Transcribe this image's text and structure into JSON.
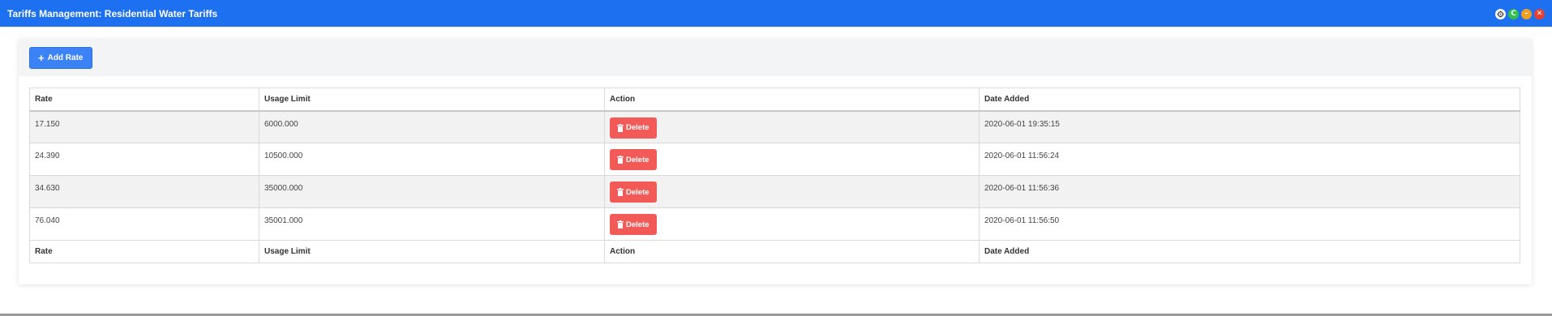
{
  "window": {
    "title": "Tariffs Management: Residential Water Tariffs",
    "controls": {
      "settings_icon": "gear-icon",
      "refresh_icon": "refresh-icon",
      "minimize_icon": "minimize-icon",
      "close_icon": "close-icon",
      "refresh_glyph": "C",
      "minimize_glyph": "–",
      "close_glyph": "✕"
    },
    "colors": {
      "titlebar": "#1d70f0"
    }
  },
  "toolbar": {
    "add_label": "Add Rate",
    "add_icon": "plus-icon"
  },
  "table": {
    "headers": [
      "Rate",
      "Usage Limit",
      "Action",
      "Date Added"
    ],
    "rows": [
      {
        "rate": "17.150",
        "usage_limit": "6000.000",
        "action": "Delete",
        "date_added": "2020-06-01 19:35:15"
      },
      {
        "rate": "24.390",
        "usage_limit": "10500.000",
        "action": "Delete",
        "date_added": "2020-06-01 11:56:24"
      },
      {
        "rate": "34.630",
        "usage_limit": "35000.000",
        "action": "Delete",
        "date_added": "2020-06-01 11:56:36"
      },
      {
        "rate": "76.040",
        "usage_limit": "35001.000",
        "action": "Delete",
        "date_added": "2020-06-01 11:56:50"
      }
    ],
    "footers": [
      "Rate",
      "Usage Limit",
      "Action",
      "Date Added"
    ],
    "delete_icon": "trash-icon",
    "colors": {
      "delete_button": "#f25a58",
      "add_button": "#3b82f6"
    }
  }
}
